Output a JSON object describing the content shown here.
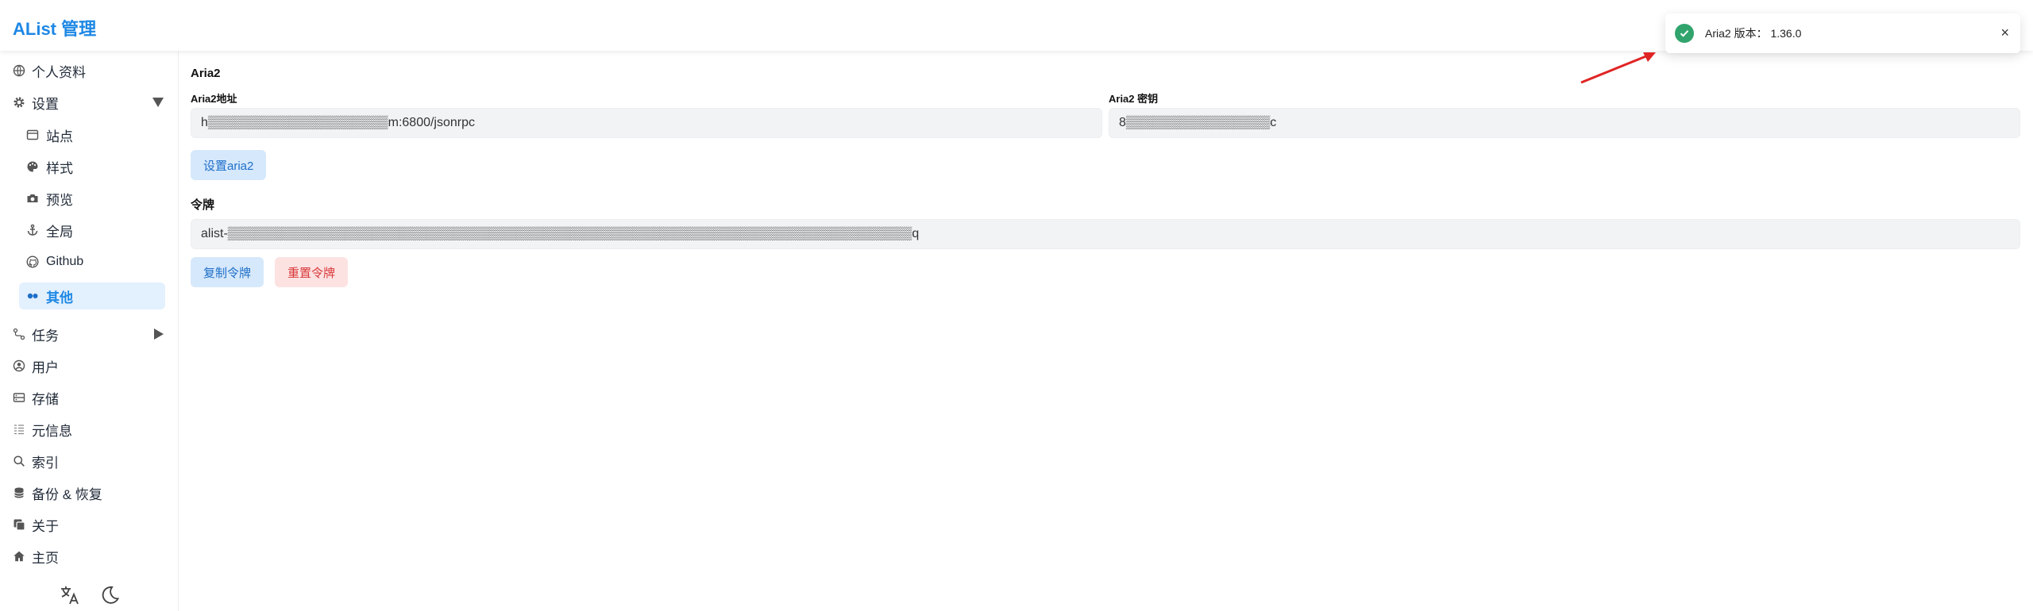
{
  "header": {
    "title": "AList 管理"
  },
  "sidebar": {
    "items": [
      {
        "label": "个人资料",
        "icon": "globe-icon"
      },
      {
        "label": "设置",
        "icon": "gear-icon"
      },
      {
        "label": "站点",
        "icon": "window-icon"
      },
      {
        "label": "样式",
        "icon": "palette-icon"
      },
      {
        "label": "预览",
        "icon": "camera-icon"
      },
      {
        "label": "全局",
        "icon": "anchor-icon"
      },
      {
        "label": "Github",
        "icon": "github-icon"
      },
      {
        "label": "其他",
        "icon": "toggle-icon"
      },
      {
        "label": "任务",
        "icon": "route-icon"
      },
      {
        "label": "用户",
        "icon": "user-circle-icon"
      },
      {
        "label": "存储",
        "icon": "storage-icon"
      },
      {
        "label": "元信息",
        "icon": "meta-icon"
      },
      {
        "label": "索引",
        "icon": "search-icon"
      },
      {
        "label": "备份 & 恢复",
        "icon": "database-icon"
      },
      {
        "label": "关于",
        "icon": "copy-icon"
      },
      {
        "label": "主页",
        "icon": "home-icon"
      }
    ]
  },
  "main": {
    "aria2_title": "Aria2",
    "aria2_url_label": "Aria2地址",
    "aria2_url_value": "h▒▒▒▒▒▒▒▒▒▒▒▒▒▒▒▒▒▒▒▒m:6800/jsonrpc",
    "aria2_secret_label": "Aria2 密钥",
    "aria2_secret_value": "8▒▒▒▒▒▒▒▒▒▒▒▒▒▒▒▒c",
    "set_aria2_button": "设置aria2",
    "token_title": "令牌",
    "token_value": "alist-▒▒▒▒▒▒▒▒▒▒▒▒▒▒▒▒▒▒▒▒▒▒▒▒▒▒▒▒▒▒▒▒▒▒▒▒▒▒▒▒▒▒▒▒▒▒▒▒▒▒▒▒▒▒▒▒▒▒▒▒▒▒▒▒▒▒▒▒▒▒▒▒▒▒▒▒q",
    "copy_token_button": "复制令牌",
    "reset_token_button": "重置令牌"
  },
  "toast": {
    "message": "Aria2 版本： 1.36.0",
    "close": "×",
    "status_color": "#30a46c"
  },
  "colors": {
    "accent": "#1e88e5",
    "danger": "#d93838",
    "annotation_arrow": "#e02424"
  }
}
